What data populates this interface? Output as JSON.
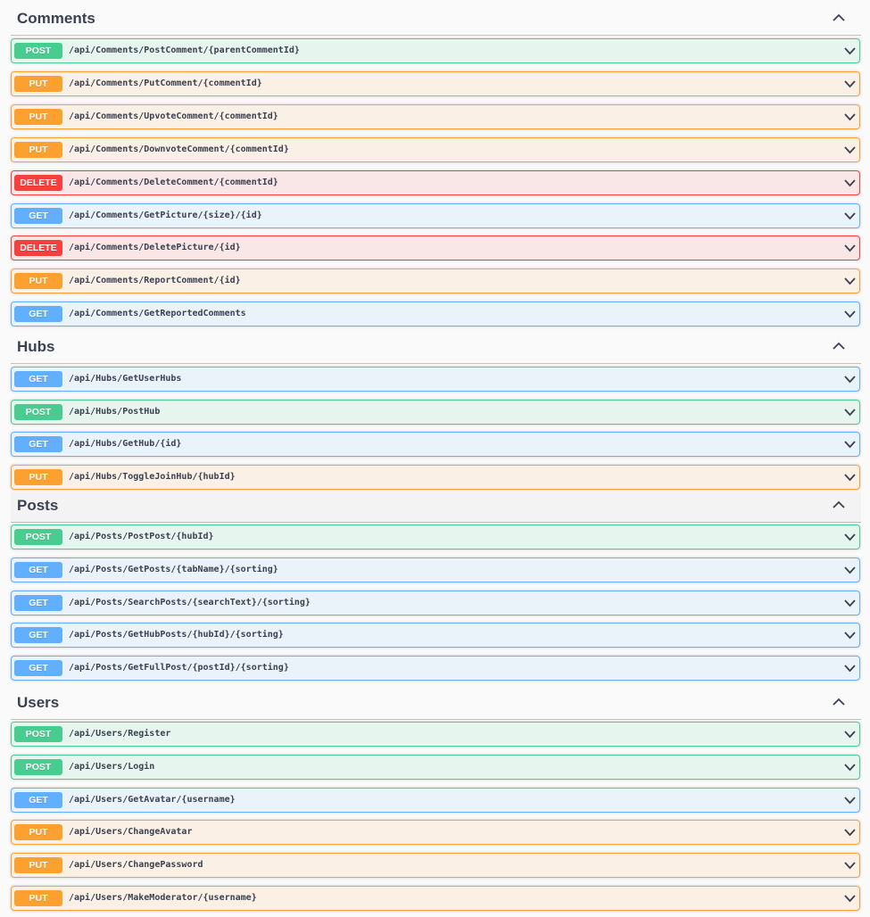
{
  "sections": [
    {
      "title": "Comments",
      "ops": [
        {
          "method": "POST",
          "path": "/api/Comments/PostComment/{parentCommentId}"
        },
        {
          "method": "PUT",
          "path": "/api/Comments/PutComment/{commentId}"
        },
        {
          "method": "PUT",
          "path": "/api/Comments/UpvoteComment/{commentId}"
        },
        {
          "method": "PUT",
          "path": "/api/Comments/DownvoteComment/{commentId}"
        },
        {
          "method": "DELETE",
          "path": "/api/Comments/DeleteComment/{commentId}"
        },
        {
          "method": "GET",
          "path": "/api/Comments/GetPicture/{size}/{id}"
        },
        {
          "method": "DELETE",
          "path": "/api/Comments/DeletePicture/{id}"
        },
        {
          "method": "PUT",
          "path": "/api/Comments/ReportComment/{id}"
        },
        {
          "method": "GET",
          "path": "/api/Comments/GetReportedComments"
        }
      ]
    },
    {
      "title": "Hubs",
      "ops": [
        {
          "method": "GET",
          "path": "/api/Hubs/GetUserHubs"
        },
        {
          "method": "POST",
          "path": "/api/Hubs/PostHub"
        },
        {
          "method": "GET",
          "path": "/api/Hubs/GetHub/{id}"
        },
        {
          "method": "PUT",
          "path": "/api/Hubs/ToggleJoinHub/{hubId}"
        }
      ]
    },
    {
      "title": "Posts",
      "hovered": true,
      "ops": [
        {
          "method": "POST",
          "path": "/api/Posts/PostPost/{hubId}"
        },
        {
          "method": "GET",
          "path": "/api/Posts/GetPosts/{tabName}/{sorting}"
        },
        {
          "method": "GET",
          "path": "/api/Posts/SearchPosts/{searchText}/{sorting}"
        },
        {
          "method": "GET",
          "path": "/api/Posts/GetHubPosts/{hubId}/{sorting}"
        },
        {
          "method": "GET",
          "path": "/api/Posts/GetFullPost/{postId}/{sorting}"
        }
      ]
    },
    {
      "title": "Users",
      "ops": [
        {
          "method": "POST",
          "path": "/api/Users/Register"
        },
        {
          "method": "POST",
          "path": "/api/Users/Login"
        },
        {
          "method": "GET",
          "path": "/api/Users/GetAvatar/{username}"
        },
        {
          "method": "PUT",
          "path": "/api/Users/ChangeAvatar"
        },
        {
          "method": "PUT",
          "path": "/api/Users/ChangePassword"
        },
        {
          "method": "PUT",
          "path": "/api/Users/MakeModerator/{username}"
        }
      ]
    }
  ],
  "icons": {
    "tag_toggle": "chevron-up-icon",
    "operation_toggle": "chevron-down-icon"
  },
  "colors": {
    "post": "#49cc90",
    "put": "#fca130",
    "get": "#61affe",
    "delete": "#f93e3e",
    "text": "#3b4151"
  }
}
